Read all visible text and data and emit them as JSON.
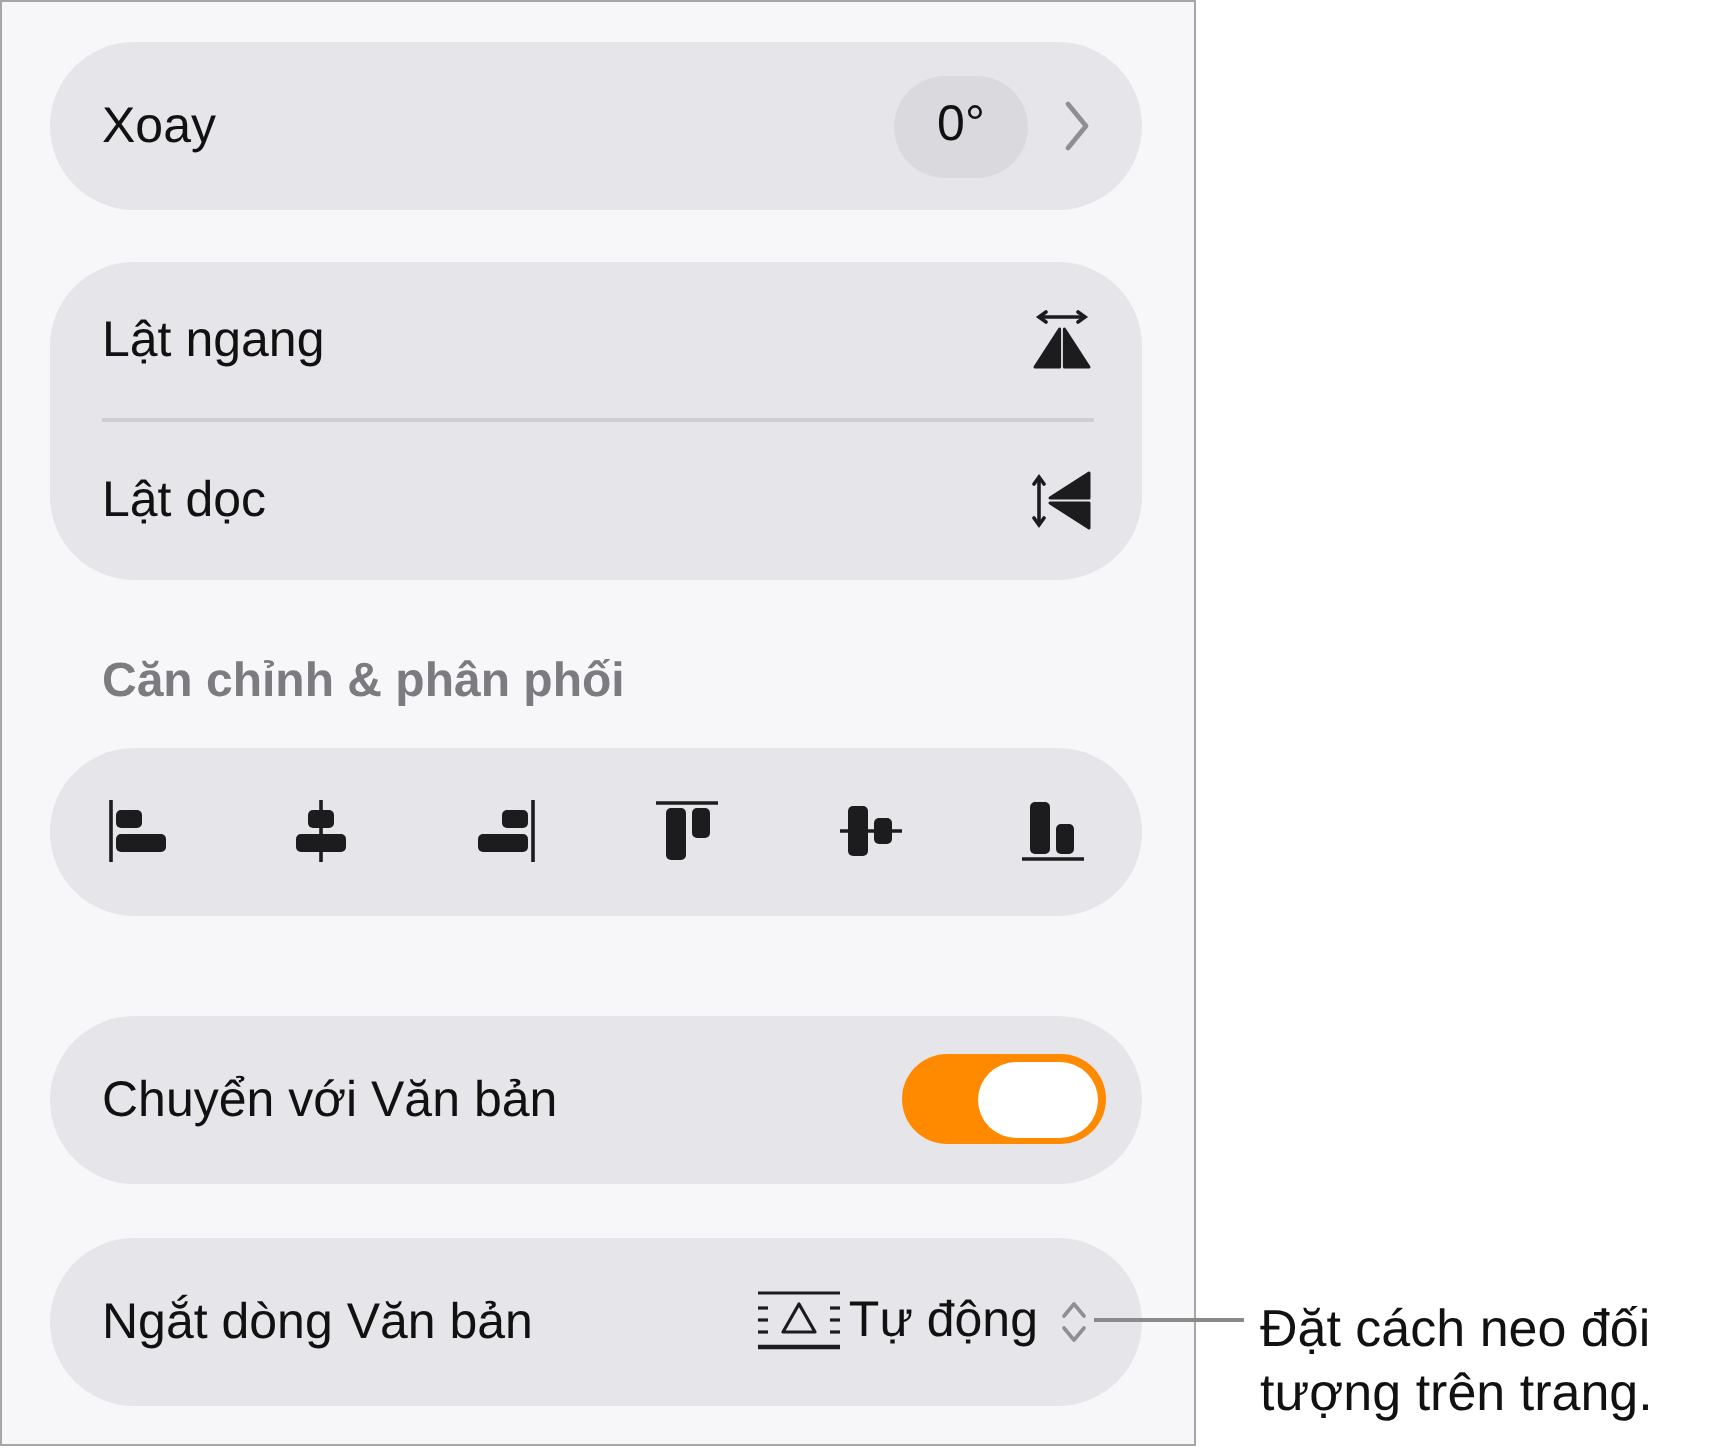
{
  "rotate": {
    "label": "Xoay",
    "value": "0°"
  },
  "flip": [
    {
      "kind": "horizontal",
      "label": "Lật ngang"
    },
    {
      "kind": "vertical",
      "label": "Lật dọc"
    }
  ],
  "align": {
    "title": "Căn chỉnh & phân phối",
    "buttons": [
      {
        "kind": "left"
      },
      {
        "kind": "center"
      },
      {
        "kind": "right"
      },
      {
        "kind": "top"
      },
      {
        "kind": "middle"
      },
      {
        "kind": "bottom"
      }
    ]
  },
  "move_with_text": {
    "label": "Chuyển với Văn bản",
    "on": true
  },
  "text_wrap": {
    "label": "Ngắt dòng Văn bản",
    "value": "Tự động"
  },
  "callout": "Đặt cách neo đối tượng trên trang."
}
